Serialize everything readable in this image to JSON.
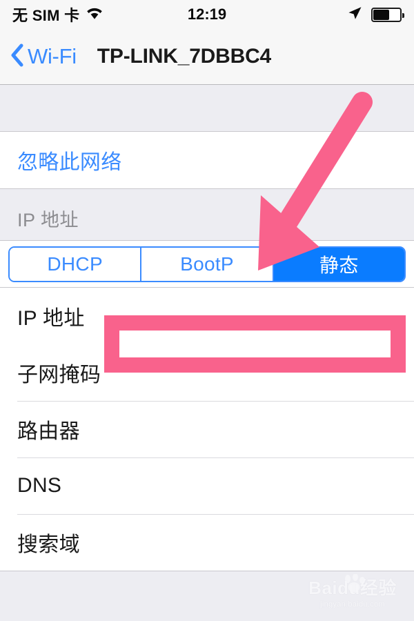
{
  "statusbar": {
    "carrier": "无 SIM 卡",
    "wifi_icon": "wifi-icon",
    "time": "12:19",
    "location_icon": "location-arrow-icon",
    "battery_icon": "battery-icon",
    "battery_level_pct": 60
  },
  "navbar": {
    "back_icon": "chevron-left-icon",
    "back_label": "Wi-Fi",
    "title": "TP-LINK_7DBBC4"
  },
  "forget_section": {
    "forget_label": "忽略此网络"
  },
  "ip_section": {
    "header": "IP 地址",
    "segmented": {
      "options": [
        "DHCP",
        "BootP",
        "静态"
      ],
      "selected": "静态",
      "selected_index": 2
    },
    "fields": [
      {
        "label": "IP 地址",
        "value": "",
        "placeholder": ""
      },
      {
        "label": "子网掩码",
        "value": "",
        "placeholder": ""
      },
      {
        "label": "路由器",
        "value": "",
        "placeholder": ""
      },
      {
        "label": "DNS",
        "value": "",
        "placeholder": ""
      },
      {
        "label": "搜索域",
        "value": "",
        "placeholder": ""
      }
    ]
  },
  "annotations": {
    "arrow_color": "#F9628C",
    "rect_color": "#F9628C",
    "arrow_target": "静态",
    "rect_target": "IP 地址 input"
  },
  "watermark": {
    "main": "Baidu经验",
    "sub": "jingyan.baidu.com",
    "logo_icon": "baidu-paw-icon"
  },
  "colors": {
    "accent_blue": "#0A7CFF",
    "link_blue": "#3A8BFF",
    "background_gray": "#EDEDF2",
    "bar_gray": "#F7F7F7",
    "annotation_pink": "#F9628C"
  }
}
